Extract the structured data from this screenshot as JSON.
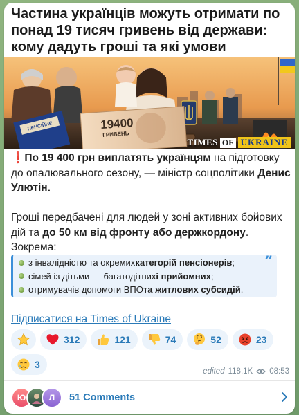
{
  "post": {
    "title": "Частина українців можуть отримати по понад 19 тисяч гривень від держави: кому дадуть гроші та які умови",
    "image": {
      "banknote_value": "19400",
      "banknote_currency": "ГРИВЕНЬ",
      "doc_label": "ПЕНСІЙНЕ",
      "brand_part1": "TIMES",
      "brand_part2": "OF",
      "brand_part3": "UKRAINE"
    },
    "p1": {
      "emoji": "❗",
      "bold1": "По 19 400 грн виплатять українцям",
      "plain1": " на підготовку до опалювального сезону, — міністр соцполітики ",
      "bold2": "Денис Улютін."
    },
    "p2": {
      "plain1": "Гроші передбачені для людей у зоні активних бойових дій та ",
      "bold1": "до 50 км від фронту або держкордону",
      "plain2": ". Зокрема:"
    },
    "quote_items": [
      {
        "plain": "з інвалідністю та окремих ",
        "bold": "категорій пенсіонерів",
        "tail": ";"
      },
      {
        "plain": "сімей із дітьми — багатодітних ",
        "bold": "і прийомних",
        "tail": ";"
      },
      {
        "plain": "отримувачів допомоги ВПО ",
        "bold": "та житлових субсидій",
        "tail": "."
      }
    ],
    "subscribe_link": "Підписатися на Times of Ukraine"
  },
  "reactions": [
    {
      "icon": "star-icon",
      "count": ""
    },
    {
      "icon": "red-heart-icon",
      "count": "312"
    },
    {
      "icon": "thumbs-up-icon",
      "count": "121"
    },
    {
      "icon": "thumbs-down-icon",
      "count": "74"
    },
    {
      "icon": "thinking-face-icon",
      "count": "52"
    },
    {
      "icon": "angry-face-icon",
      "count": "23"
    },
    {
      "icon": "crying-face-icon",
      "count": "3"
    }
  ],
  "meta": {
    "edited": "edited",
    "views": "118.1K",
    "time": "08:53"
  },
  "comments": {
    "avatars": [
      "Ю",
      "",
      "Л"
    ],
    "label": "51 Comments"
  },
  "colors": {
    "accent": "#2a7ab8",
    "quote_border": "#3b8fd9",
    "background": "#7ea776"
  }
}
